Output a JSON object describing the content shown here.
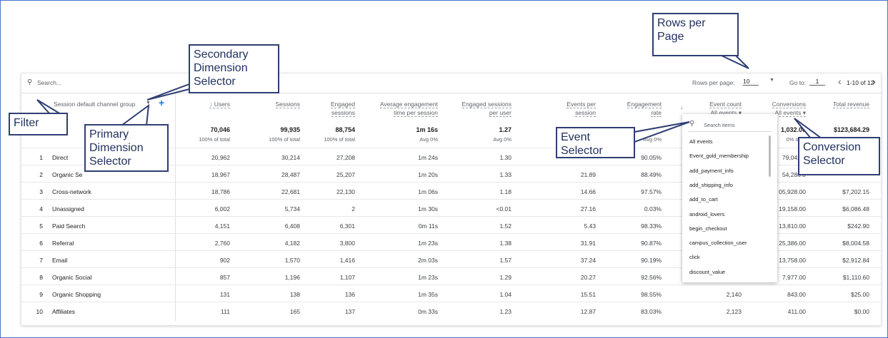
{
  "toolbar": {
    "search_placeholder": "Search...",
    "rows_per_page_label": "Rows per page:",
    "rows_per_page_value": "10",
    "goto_label": "Go to:",
    "goto_value": "1",
    "page_info": "1-10 of 12"
  },
  "dimension": {
    "header": "Session default channel group"
  },
  "columns": [
    {
      "line1": "↓ Users",
      "line2": ""
    },
    {
      "line1": "Sessions",
      "line2": ""
    },
    {
      "line1": "Engaged",
      "line2": "sessions"
    },
    {
      "line1": "Average engagement",
      "line2": "time per session"
    },
    {
      "line1": "Engaged sessions",
      "line2": "per user"
    },
    {
      "line1": "Events per",
      "line2": "session"
    },
    {
      "line1": "Engagement",
      "line2": "rate"
    },
    {
      "line1": "Event count",
      "line2": "All events ▾"
    },
    {
      "line1": "Conversions",
      "line2": "All events ▾"
    },
    {
      "line1": "Total revenue",
      "line2": ""
    }
  ],
  "totals": [
    {
      "value": "70,046",
      "sub": "100% of total"
    },
    {
      "value": "99,935",
      "sub": "100% of total"
    },
    {
      "value": "88,754",
      "sub": "100% of total"
    },
    {
      "value": "1m 16s",
      "sub": "Avg 0%"
    },
    {
      "value": "1.27",
      "sub": "Avg 0%"
    },
    {
      "value": "",
      "sub": ""
    },
    {
      "value": "",
      "sub": "Avg 0%"
    },
    {
      "value": "",
      "sub": ""
    },
    {
      "value": "1,032.00",
      "sub": "0% of to"
    },
    {
      "value": "$123,684.29",
      "sub": ""
    }
  ],
  "rows": [
    {
      "idx": "1",
      "label": "Direct",
      "cells": [
        "20,962",
        "30,214",
        "27,208",
        "1m 24s",
        "1.30",
        "",
        "90.05%",
        "",
        "79,042.0",
        ""
      ]
    },
    {
      "idx": "2",
      "label": "Organic Se",
      "cells": [
        "18,967",
        "28,487",
        "25,207",
        "1m 20s",
        "1.33",
        "21.89",
        "88.49%",
        "",
        "54,286.0",
        ""
      ]
    },
    {
      "idx": "3",
      "label": "Cross-network",
      "cells": [
        "18,786",
        "22,681",
        "22,130",
        "1m 06s",
        "1.18",
        "14.66",
        "97.57%",
        "",
        "05,928.00",
        "$7,202.15"
      ]
    },
    {
      "idx": "4",
      "label": "Unassigned",
      "cells": [
        "6,002",
        "5,734",
        "2",
        "1m 30s",
        "<0.01",
        "27.16",
        "0.03%",
        "",
        "19,158.00",
        "$6,086.48"
      ]
    },
    {
      "idx": "5",
      "label": "Paid Search",
      "cells": [
        "4,151",
        "6,408",
        "6,301",
        "0m 11s",
        "1.52",
        "5.43",
        "98.33%",
        "",
        "13,810.00",
        "$242.90"
      ]
    },
    {
      "idx": "6",
      "label": "Referral",
      "cells": [
        "2,760",
        "4,182",
        "3,800",
        "1m 23s",
        "1.38",
        "31.91",
        "90.87%",
        "",
        "25,386.00",
        "$8,004.58"
      ]
    },
    {
      "idx": "7",
      "label": "Email",
      "cells": [
        "902",
        "1,570",
        "1,416",
        "2m 03s",
        "1.57",
        "37.24",
        "90.19%",
        "",
        "13,758.00",
        "$2,912.84"
      ]
    },
    {
      "idx": "8",
      "label": "Organic Social",
      "cells": [
        "857",
        "1,196",
        "1,107",
        "1m 23s",
        "1.29",
        "20.27",
        "92.56%",
        "",
        "7,977.00",
        "$1,110.60"
      ]
    },
    {
      "idx": "9",
      "label": "Organic Shopping",
      "cells": [
        "131",
        "138",
        "136",
        "1m 35s",
        "1.04",
        "15.51",
        "98.55%",
        "2,140",
        "843.00",
        "$25.00"
      ]
    },
    {
      "idx": "10",
      "label": "Affiliates",
      "cells": [
        "111",
        "165",
        "137",
        "0m 33s",
        "1.23",
        "12.87",
        "83.03%",
        "2,123",
        "411.00",
        "$0.00"
      ]
    }
  ],
  "dropdown": {
    "search_placeholder": "Search items",
    "items": [
      "All events",
      "Event_gold_membership",
      "add_payment_info",
      "add_shipping_info",
      "add_to_cart",
      "android_lovers",
      "begin_checkout",
      "campus_collection_user",
      "click",
      "discount_value"
    ]
  },
  "callouts": {
    "rows_per_page": "Rows per\nPage",
    "secondary_dimension": "Secondary\nDimension\nSelector",
    "filter": "Filter",
    "primary_dimension": "Primary\nDimension\nSelector",
    "event_selector": "Event\nSelector",
    "conversion_selector": "Conversion\nSelector"
  },
  "colors": {
    "accent": "#1a73e8",
    "callout_border": "#2f3e73",
    "callout_text": "#1f2f5e",
    "frame_border": "#4a74c9"
  }
}
